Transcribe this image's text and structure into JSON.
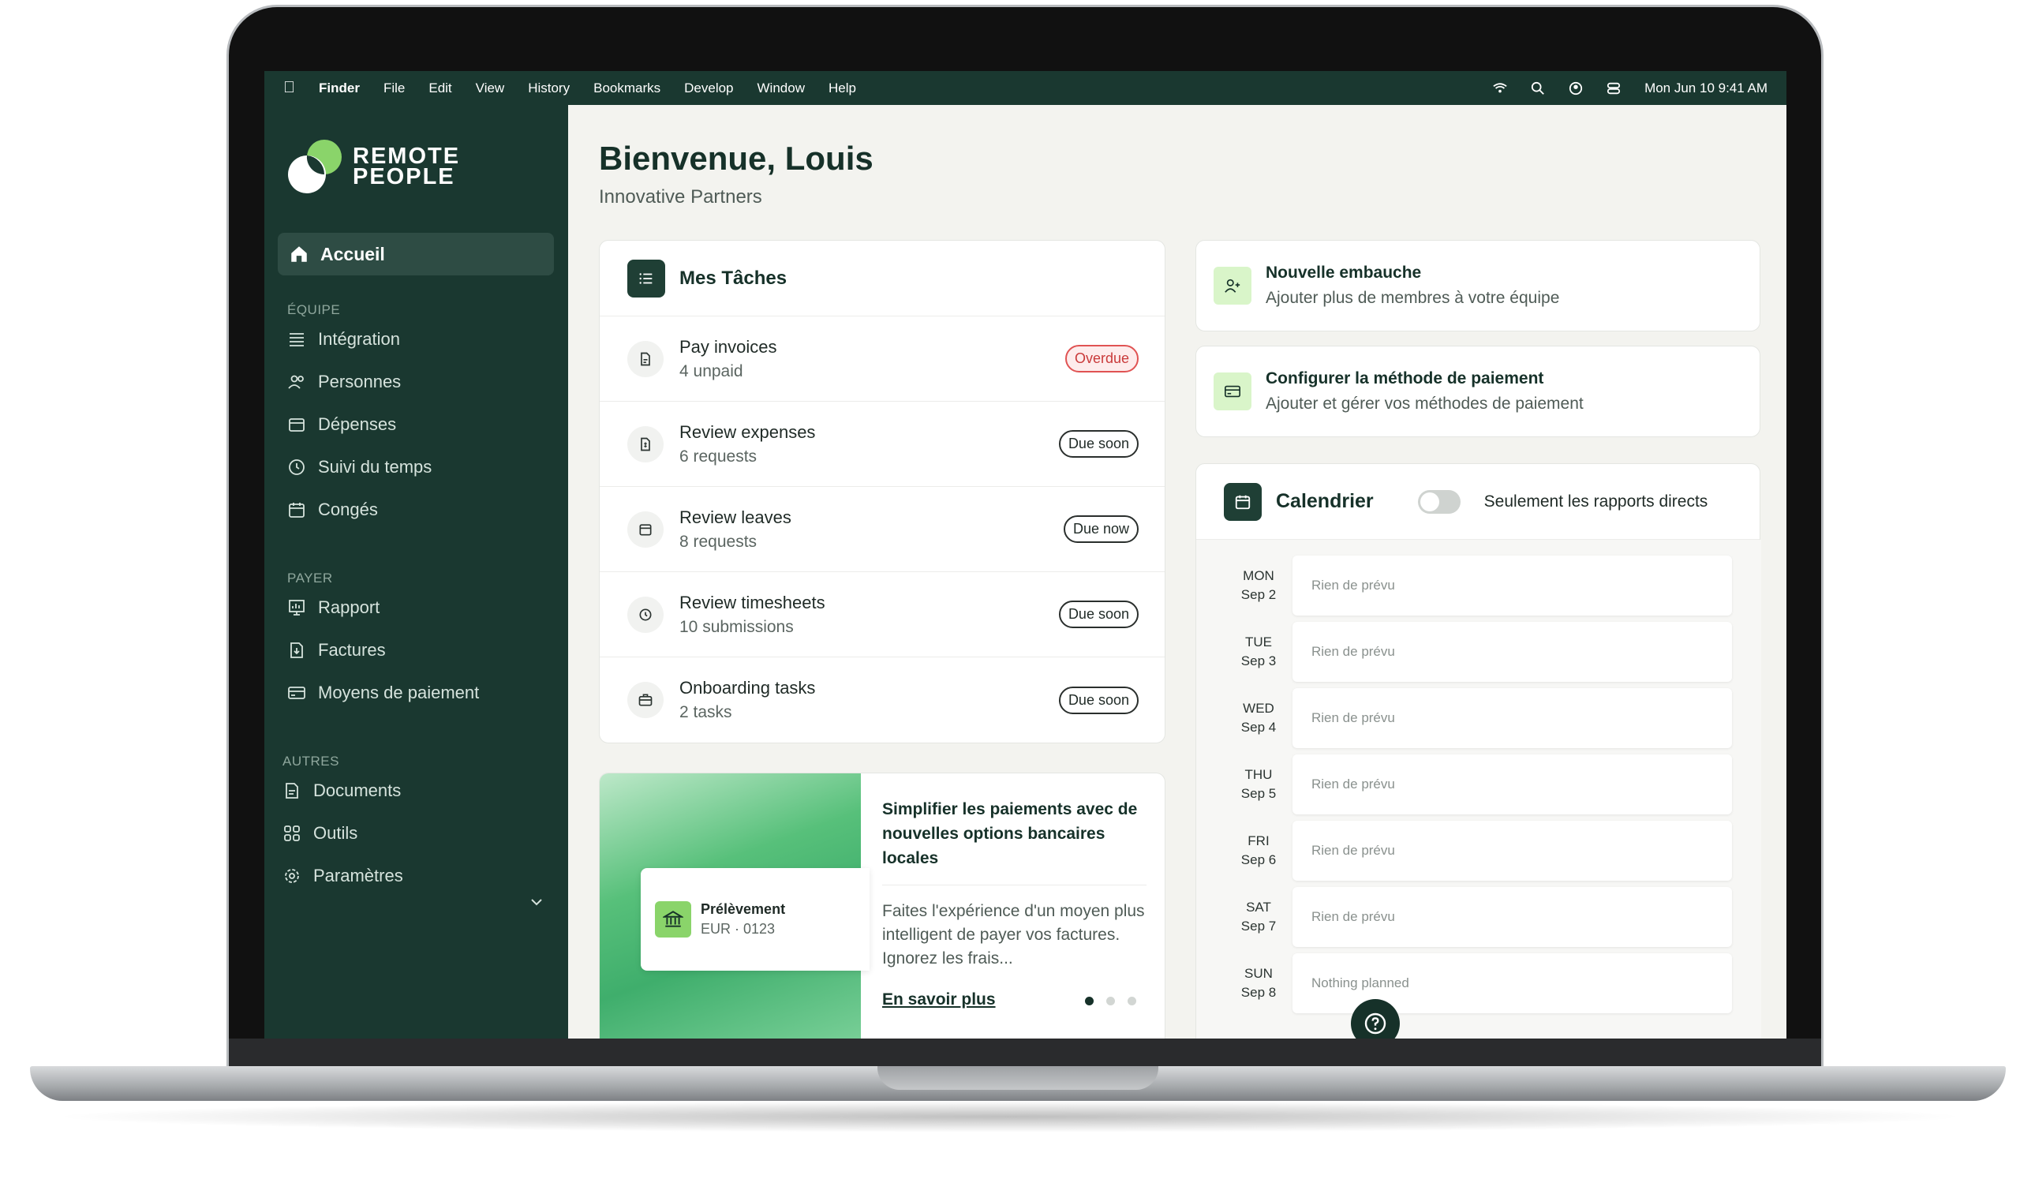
{
  "menubar": {
    "items": [
      "Finder",
      "File",
      "Edit",
      "View",
      "History",
      "Bookmarks",
      "Develop",
      "Window",
      "Help"
    ],
    "datetime": "Mon Jun 10  9:41 AM"
  },
  "brand": {
    "line1": "REMOTE",
    "line2": "PEOPLE",
    "accent": "#8ad46a"
  },
  "sidebar": {
    "active": "Accueil",
    "sections": {
      "equipe": "ÉQUIPE",
      "payer": "PAYER",
      "autres": "AUTRES"
    },
    "equipe_items": [
      "Intégration",
      "Personnes",
      "Dépenses",
      "Suivi du temps",
      "Congés"
    ],
    "payer_items": [
      "Rapport",
      "Factures",
      "Moyens de paiement"
    ],
    "autres_items": [
      "Documents",
      "Outils",
      "Paramètres"
    ]
  },
  "header": {
    "title": "Bienvenue, Louis",
    "subtitle": "Innovative Partners"
  },
  "tasks": {
    "title": "Mes Tâches",
    "items": [
      {
        "name": "Pay invoices",
        "sub": "4 unpaid",
        "status": "Overdue",
        "icon": "invoice-icon"
      },
      {
        "name": "Review expenses",
        "sub": "6 requests",
        "status": "Due soon",
        "icon": "receipt-icon"
      },
      {
        "name": "Review leaves",
        "sub": "8 requests",
        "status": "Due now",
        "icon": "calendar-icon"
      },
      {
        "name": "Review timesheets",
        "sub": "10 submissions",
        "status": "Due soon",
        "icon": "clock-icon"
      },
      {
        "name": "Onboarding tasks",
        "sub": "2 tasks",
        "status": "Due soon",
        "icon": "briefcase-icon"
      }
    ]
  },
  "promo": {
    "card_name": "Prélèvement",
    "card_sub": "EUR · 0123",
    "title": "Simplifier les paiements avec de nouvelles options bancaires locales",
    "text": "Faites l'expérience d'un moyen plus intelligent de payer vos factures. Ignorez les frais...",
    "link": "En savoir plus"
  },
  "actions": [
    {
      "title": "Nouvelle embauche",
      "sub": "Ajouter plus de membres à votre équipe"
    },
    {
      "title": "Configurer la méthode de paiement",
      "sub": "Ajouter et gérer vos méthodes de paiement"
    }
  ],
  "calendar": {
    "title": "Calendrier",
    "toggle_label": "Seulement les rapports directs",
    "toggle_on": false,
    "days": [
      {
        "dow": "MON",
        "date": "Sep 2",
        "text": "Rien de prévu"
      },
      {
        "dow": "TUE",
        "date": "Sep 3",
        "text": "Rien de prévu"
      },
      {
        "dow": "WED",
        "date": "Sep 4",
        "text": "Rien de prévu"
      },
      {
        "dow": "THU",
        "date": "Sep 5",
        "text": "Rien de prévu"
      },
      {
        "dow": "FRI",
        "date": "Sep 6",
        "text": "Rien de prévu"
      },
      {
        "dow": "SAT",
        "date": "Sep 7",
        "text": "Rien de prévu"
      },
      {
        "dow": "SUN",
        "date": "Sep 8",
        "text": "Nothing planned"
      }
    ]
  }
}
